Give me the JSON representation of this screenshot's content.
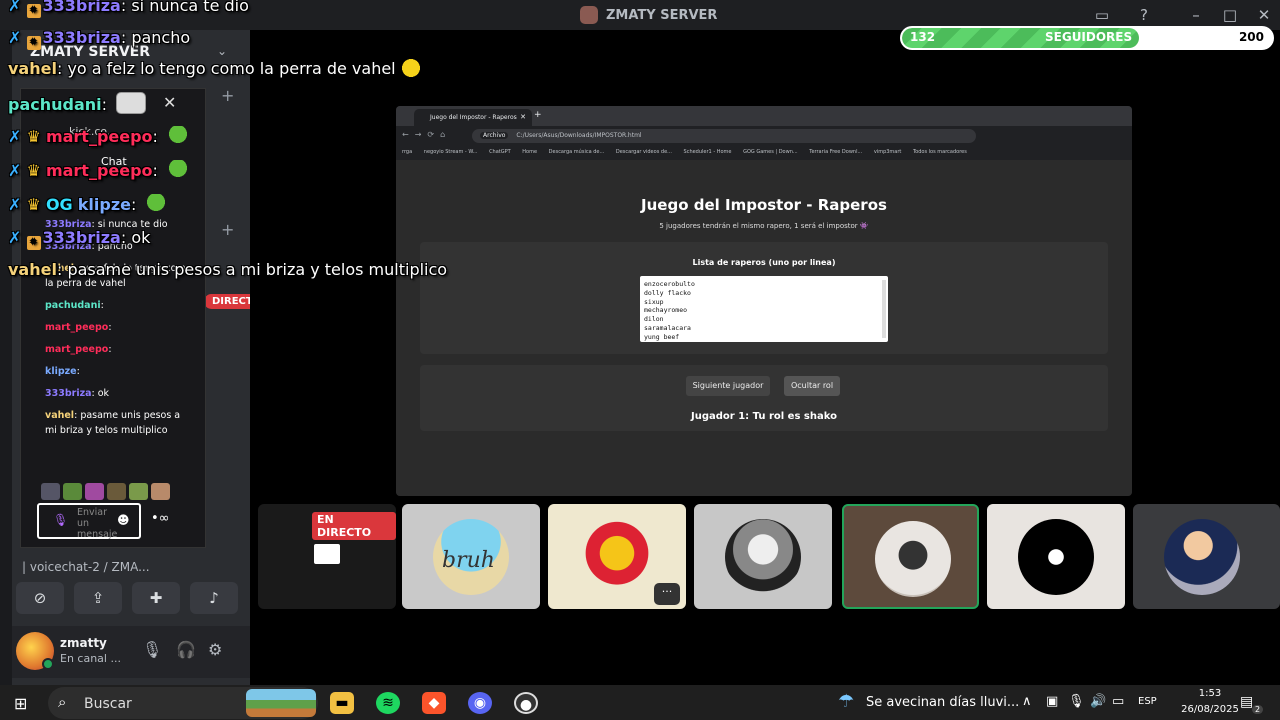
{
  "window": {
    "title": "ZMATY SERVER"
  },
  "followers": {
    "current": "132",
    "label": "SEGUIDORES",
    "goal": "200",
    "progress": 0.64
  },
  "sidebar": {
    "server_name": "ZMATY SERVER",
    "live_badge": "DIRECTO",
    "voice_channel": "| voicechat-2 / ZMA...",
    "user": {
      "name": "zmatty",
      "status": "En canal ..."
    }
  },
  "browser": {
    "tab_title": "Juego del Impostor - Raperos",
    "address_chip": "Archivo",
    "url": "C:/Users/Asus/Downloads/IMPOSTOR.html",
    "bookmarks": [
      "rrga",
      "negoyio Stream - W...",
      "ChatGPT",
      "Home",
      "Descarga música de...",
      "Descargar videos de...",
      "Scheduler1 - Home",
      "GOG Games | Down...",
      "Terraria Free Downl...",
      "vimp3mart",
      "Todos los marcadores"
    ]
  },
  "game": {
    "title": "Juego del Impostor - Raperos",
    "subtitle": "5 jugadores tendrán el mismo rapero, 1 será el impostor 👾",
    "list_label": "Lista de raperos (uno por linea)",
    "rappers": [
      "enzocerobulto",
      "dolly flacko",
      "sixup",
      "mechayromeo",
      "dilon",
      "saramalacara",
      "yung beef"
    ],
    "next_button": "Siguiente jugador",
    "hide_button": "Ocultar rol",
    "role_text": "Jugador 1: Tu rol es shako"
  },
  "stream": {
    "live_label": "EN DIRECTO"
  },
  "tiles": {
    "bruh_text": "bruh"
  },
  "overlay_chat": [
    {
      "user": "333briza",
      "msg": "si nunca te dio",
      "cls": "u-briza",
      "badges": "briza"
    },
    {
      "user": "333briza",
      "msg": "pancho",
      "cls": "u-briza",
      "badges": "briza"
    },
    {
      "user": "vahel",
      "msg": "yo a felz lo tengo como la perra de vahel",
      "cls": "u-vahel",
      "badges": ""
    },
    {
      "user": "pachudani",
      "msg": "",
      "cls": "u-pach",
      "badges": ""
    },
    {
      "user": "mart_peepo",
      "msg": "",
      "cls": "u-peepo",
      "badges": "peepo"
    },
    {
      "user": "mart_peepo",
      "msg": "",
      "cls": "u-peepo",
      "badges": "peepo"
    },
    {
      "user": "klipze",
      "msg": "",
      "cls": "u-klip",
      "badges": "klip"
    },
    {
      "user": "333briza",
      "msg": "ok",
      "cls": "u-briza",
      "badges": "briza"
    },
    {
      "user": "vahel",
      "msg": "pasame unis pesos a mi briza y telos multiplico",
      "cls": "u-vahel",
      "badges": ""
    }
  ],
  "kick": {
    "url": "kick.co...",
    "chat_label": "Chat",
    "messages": [
      {
        "user": "333briza",
        "msg": "si nunca te dio",
        "cls": "u-briza"
      },
      {
        "user": "333briza",
        "msg": "pancho",
        "cls": "u-briza"
      },
      {
        "user": "vahel",
        "msg": "yo a felz lo tengo como la perra de vahel",
        "cls": "u-vahel"
      },
      {
        "user": "pachudani",
        "msg": "",
        "cls": "u-pach"
      },
      {
        "user": "mart_peepo",
        "msg": "",
        "cls": "u-peepo"
      },
      {
        "user": "mart_peepo",
        "msg": "",
        "cls": "u-peepo"
      },
      {
        "user": "klipze",
        "msg": "",
        "cls": "u-klip"
      },
      {
        "user": "333briza",
        "msg": "ok",
        "cls": "u-briza"
      },
      {
        "user": "vahel",
        "msg": "pasame unis pesos a mi briza y telos multiplico",
        "cls": "u-vahel"
      }
    ],
    "input_placeholder": "Enviar un mensaje"
  },
  "taskbar": {
    "search_placeholder": "Buscar",
    "weather": "Se avecinan días lluvi...",
    "language": "ESP",
    "time": "1:53",
    "date": "26/08/2025",
    "notifications": "2"
  }
}
